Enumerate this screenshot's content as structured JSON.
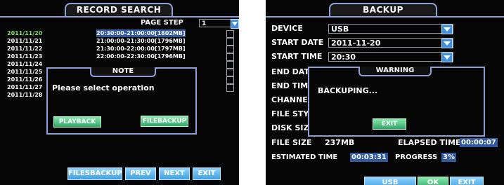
{
  "record_search": {
    "title": "RECORD SEARCH",
    "page_step_label": "PAGE STEP",
    "page_step_value": "1",
    "dates": [
      "2011/11/20",
      "2011/11/21",
      "2011/11/22",
      "2011/11/23",
      "2011/11/24",
      "2011/11/25",
      "2011/11/26",
      "2011/11/27",
      "2011/11/28"
    ],
    "time_rows": [
      "20:30:00-21:00:00[1802MB]",
      "21:00:00-21:30:00[1796MB]",
      "21:30:00-22:00:00[1797MB]",
      "22:00:00-22:30:00[1796MB]"
    ],
    "note": {
      "title": "NOTE",
      "message": "Please select operation",
      "playback_label": "PLAYBACK",
      "filebackup_label": "FILEBACKUP"
    },
    "buttons": {
      "filesbackup": "FILESBACKUP",
      "prev": "PREV",
      "next": "NEXT",
      "exit": "EXIT"
    }
  },
  "backup": {
    "title": "BACKUP",
    "device_label": "DEVICE",
    "device_value": "USB",
    "start_date_label": "START DATE",
    "start_date_value": "2011-11-20",
    "start_time_label": "START TIME",
    "start_time_value": "20:30",
    "end_date_label": "END DATE",
    "end_time_label": "END TIME",
    "channel_label": "CHANNEL",
    "file_style_label": "FILE STY",
    "disk_size_label": "DISK SIZ",
    "file_size_label": "FILE SIZE",
    "file_size_value": "237MB",
    "elapsed_time_label": "ELAPSED TIME",
    "elapsed_time_value": "00:00:07",
    "estimated_time_label": "ESTIMATED TIME",
    "estimated_time_value": "00:03:31",
    "progress_label": "PROGRESS",
    "progress_value": "3%",
    "warning": {
      "title": "WARNING",
      "message": "BACKUPING...",
      "exit_label": "EXIT"
    },
    "buttons": {
      "usb_format": "USB FORMAT",
      "ok": "OK",
      "exit": "EXIT"
    }
  },
  "colors": {
    "screen_bg": "#050505",
    "border_blue": "#8fa0d8",
    "selected_date": "#7ee05c",
    "highlight_blue": "#2f5aa0",
    "button_blue": "#3e9fe0",
    "button_green": "#2fa66a"
  }
}
